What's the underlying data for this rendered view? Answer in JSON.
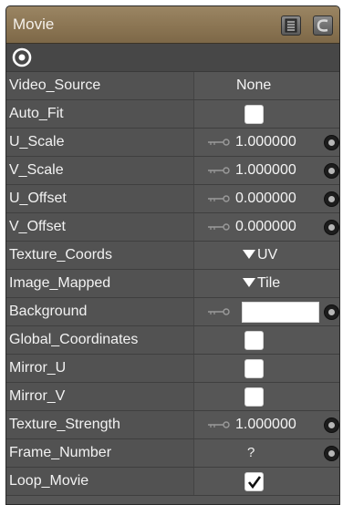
{
  "panel": {
    "title": "Movie",
    "header_buttons": [
      "list-view-icon",
      "wrap-icon"
    ],
    "node_icon": "target-icon"
  },
  "properties": [
    {
      "label": "Video_Source",
      "value": "None",
      "kind": "text"
    },
    {
      "label": "Auto_Fit",
      "kind": "checkbox",
      "checked": false
    },
    {
      "label": "U_Scale",
      "value": "1.000000",
      "kind": "numeric"
    },
    {
      "label": "V_Scale",
      "value": "1.000000",
      "kind": "numeric"
    },
    {
      "label": "U_Offset",
      "value": "0.000000",
      "kind": "numeric"
    },
    {
      "label": "V_Offset",
      "value": "0.000000",
      "kind": "numeric"
    },
    {
      "label": "Texture_Coords",
      "value": "UV",
      "kind": "dropdown"
    },
    {
      "label": "Image_Mapped",
      "value": "Tile",
      "kind": "dropdown"
    },
    {
      "label": "Background",
      "kind": "color",
      "color": "#ffffff"
    },
    {
      "label": "Global_Coordinates",
      "kind": "checkbox",
      "checked": false
    },
    {
      "label": "Mirror_U",
      "kind": "checkbox",
      "checked": false
    },
    {
      "label": "Mirror_V",
      "kind": "checkbox",
      "checked": false
    },
    {
      "label": "Texture_Strength",
      "value": "1.000000",
      "kind": "numeric"
    },
    {
      "label": "Frame_Number",
      "value": "?",
      "kind": "unknown"
    },
    {
      "label": "Loop_Movie",
      "kind": "checkbox",
      "checked": true
    }
  ],
  "colors": {
    "header": "#8b7553",
    "row_bg": "#525252",
    "text": "#f2f2f2"
  }
}
